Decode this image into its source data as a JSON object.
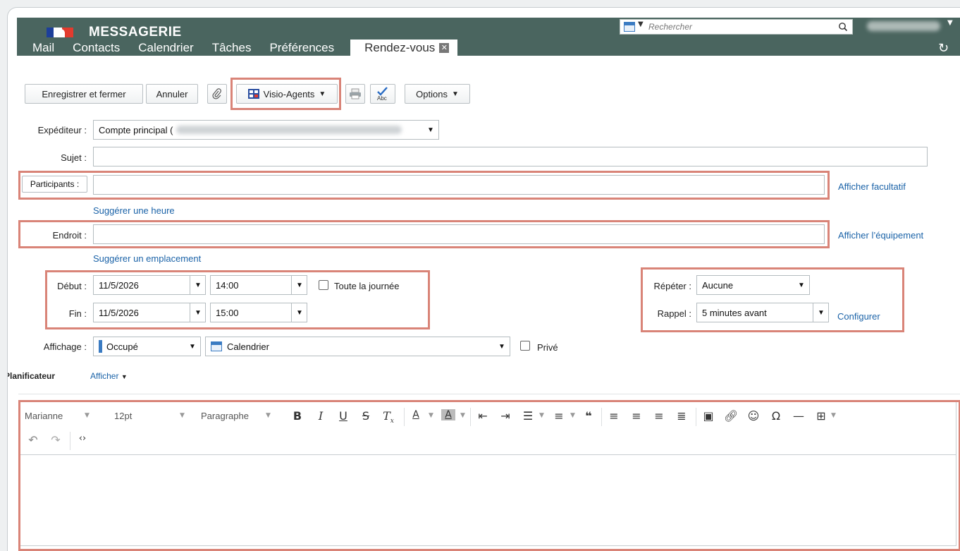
{
  "header": {
    "app_title": "MESSAGERIE",
    "search_placeholder": "Rechercher",
    "tabs": [
      {
        "label": "Mail"
      },
      {
        "label": "Contacts"
      },
      {
        "label": "Calendrier"
      },
      {
        "label": "Tâches"
      },
      {
        "label": "Préférences"
      },
      {
        "label": "Rendez-vous",
        "active": true
      }
    ],
    "tab_close_glyph": "✕",
    "refresh_glyph": "↻",
    "colors": {
      "header_bg": "#4a655f",
      "highlight": "#d98478",
      "link": "#1b63a8"
    }
  },
  "toolbar": {
    "save_close": "Enregistrer et fermer",
    "cancel": "Annuler",
    "visio": "Visio-Agents",
    "options": "Options"
  },
  "form": {
    "sender_label": "Expéditeur :",
    "sender_value": "Compte principal (",
    "subject_label": "Sujet :",
    "subject_value": "",
    "participants_label": "Participants :",
    "participants_value": "",
    "show_optional": "Afficher facultatif",
    "suggest_time": "Suggérer une heure",
    "location_label": "Endroit :",
    "location_value": "",
    "show_equipment": "Afficher l’équipement",
    "suggest_location": "Suggérer un emplacement",
    "start_label": "Début :",
    "start_date": "11/5/2026",
    "start_time": "14:00",
    "all_day": "Toute la journée",
    "end_label": "Fin :",
    "end_date": "11/5/2026",
    "end_time": "15:00",
    "repeat_label": "Répéter :",
    "repeat_value": "Aucune",
    "reminder_label": "Rappel :",
    "reminder_value": "5 minutes avant",
    "configure": "Configurer",
    "display_label": "Affichage :",
    "display_value": "Occupé",
    "calendar_value": "Calendrier",
    "private": "Privé",
    "scheduler_label": "Planificateur",
    "scheduler_show": "Afficher"
  },
  "editor": {
    "font": "Marianne",
    "size": "12pt",
    "block": "Paragraphe"
  }
}
